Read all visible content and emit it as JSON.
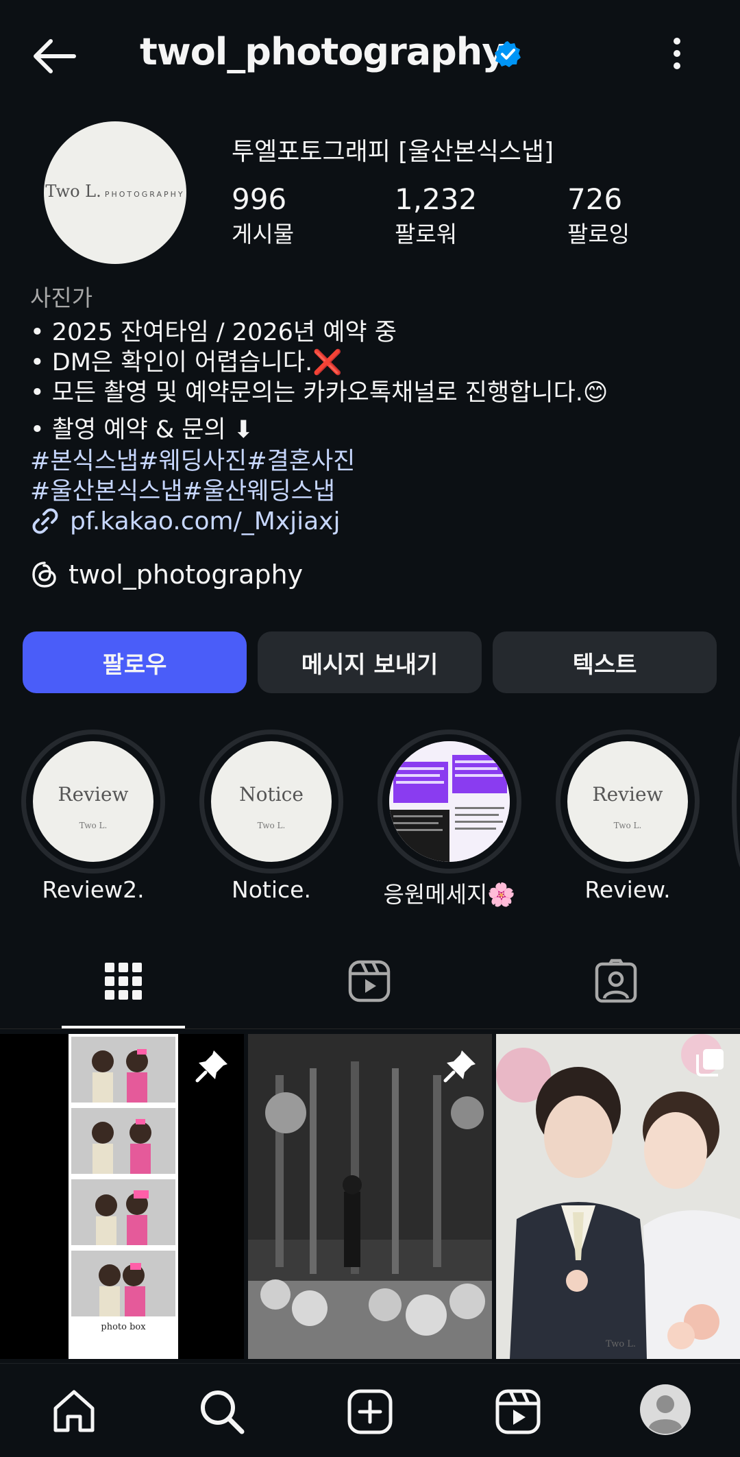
{
  "header": {
    "username": "twol_photography",
    "verified": true,
    "icons": [
      "back-arrow-icon",
      "verified-badge-icon",
      "more-vertical-icon"
    ]
  },
  "profile": {
    "full_name": "투엘포토그래피 [울산본식스냅]",
    "avatar_text": "Two L.",
    "avatar_subtext": "PHOTOGRAPHY",
    "stats": [
      {
        "value": "996",
        "label": "게시물"
      },
      {
        "value": "1,232",
        "label": "팔로워"
      },
      {
        "value": "726",
        "label": "팔로잉"
      }
    ]
  },
  "bio": {
    "category": "사진가",
    "lines": [
      "• 2025 잔여타임 / 2026년 예약 중",
      "• DM은 확인이 어렵습니다.❌",
      "• 모든 촬영 및 예약문의는 카카오톡채널로 진행합니다.😊",
      "• 촬영 예약 & 문의 ⬇"
    ],
    "hashtags": [
      "#본식스냅#웨딩사진#결혼사진",
      "#울산본식스냅#울산웨딩스냅"
    ],
    "link": "pf.kakao.com/_Mxjiaxj",
    "threads_handle": "twol_photography"
  },
  "actions": {
    "follow": "팔로우",
    "message": "메시지 보내기",
    "text": "텍스트"
  },
  "highlights": [
    {
      "label": "Review2.",
      "cover_text": "Review",
      "cover_sub": "Two L."
    },
    {
      "label": "Notice.",
      "cover_text": "Notice",
      "cover_sub": "Two L."
    },
    {
      "label": "응원메세지🌸",
      "cover_text": "",
      "cover_sub": ""
    },
    {
      "label": "Review.",
      "cover_text": "Review",
      "cover_sub": "Two L."
    }
  ],
  "tabs": [
    "grid-icon",
    "reels-icon",
    "tagged-icon"
  ],
  "active_tab": "grid",
  "grid": [
    {
      "pinned": true,
      "caption": "photo box"
    },
    {
      "pinned": true
    },
    {
      "multi": true,
      "watermark": "Two L."
    }
  ],
  "bottom_nav": [
    "home-icon",
    "search-icon",
    "create-icon",
    "reels-icon",
    "profile-avatar"
  ],
  "colors": {
    "background": "#0c1014",
    "follow_button": "#4a5df9",
    "secondary_button": "#25292e",
    "link": "#c7d7fe",
    "verified": "#0095f6"
  }
}
